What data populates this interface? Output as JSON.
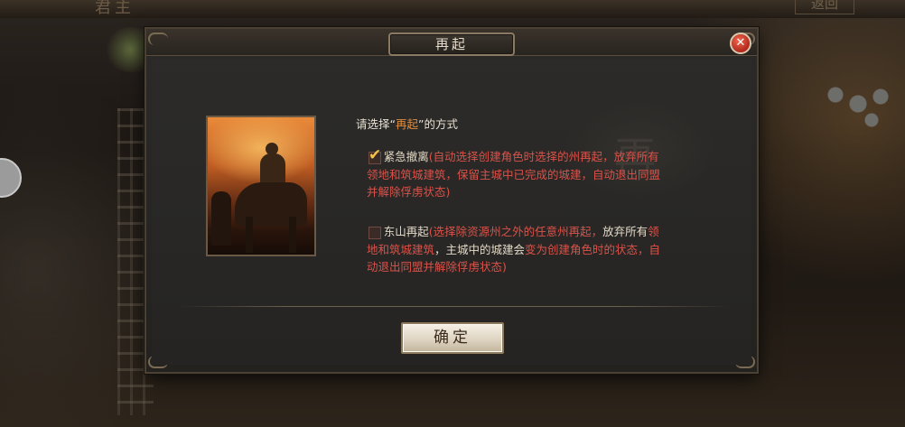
{
  "background": {
    "title": "君主",
    "back_label": "返回"
  },
  "dialog": {
    "title": "再起",
    "close_icon": "close-icon",
    "watermark": "再",
    "prompt_prefix": "请选择“",
    "prompt_highlight": "再起",
    "prompt_suffix": "”的方式",
    "options": [
      {
        "name": "紧急撤离",
        "checked": true,
        "desc_part1": "(自动选择创建角色时选择的州再起，放弃所有",
        "desc_part2": "领地和筑城建筑",
        "desc_part3": "，保留主城中已完成的城建，",
        "desc_part4": "自动退出同盟并解除俘虏状态",
        "desc_part5": ")"
      },
      {
        "name": "东山再起",
        "checked": false,
        "desc_part1": "(选择除资源州之外的任意州再起，",
        "desc_part2": "放弃所有",
        "desc_part3": "领地和筑城建筑",
        "desc_part4": "，主城中的城建会",
        "desc_part5": "变为创建角色时的状态，自动退出同盟并解除俘虏状态)"
      }
    ],
    "confirm_label": "确定"
  },
  "colors": {
    "accent_orange": "#e28b3b",
    "warning_red": "#d9524a",
    "checkmark_gold": "#f3c24a"
  }
}
